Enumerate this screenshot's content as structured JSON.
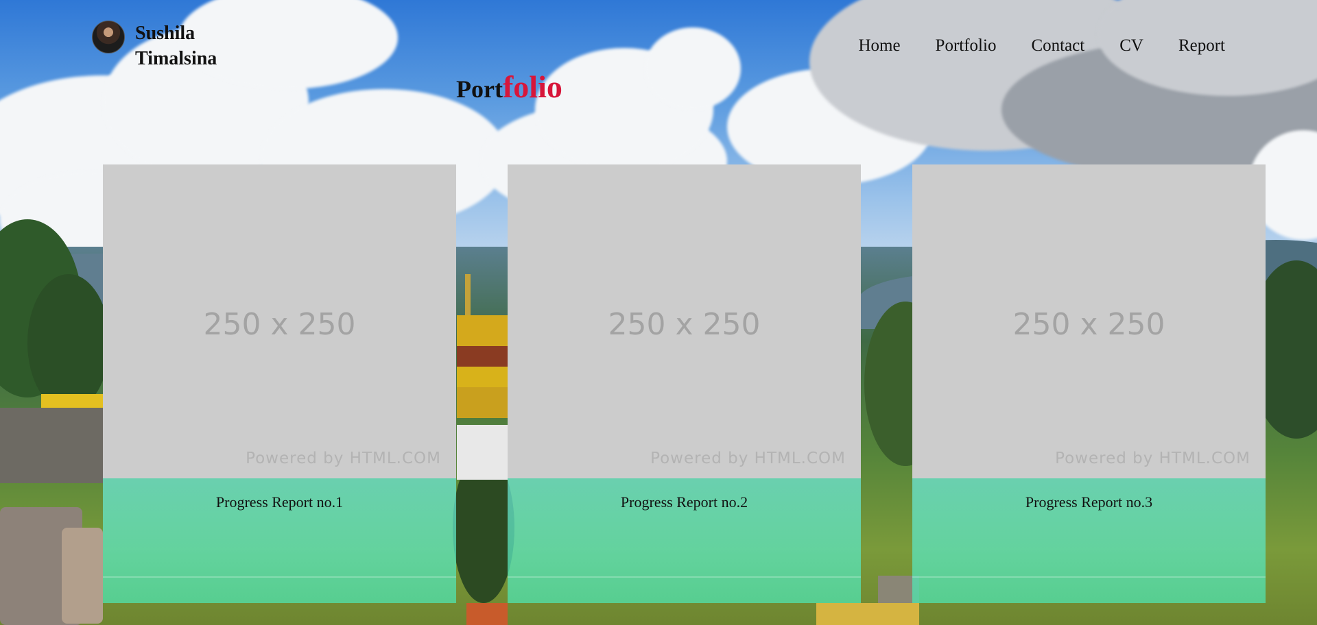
{
  "brand": {
    "name": "Sushila Timalsina"
  },
  "nav": {
    "items": [
      "Home",
      "Portfolio",
      "Contact",
      "CV",
      "Report"
    ]
  },
  "title": {
    "part1": "Port",
    "part2": "folio",
    "accent_color": "#d7163a"
  },
  "cards": [
    {
      "placeholder_size": "250 x 250",
      "placeholder_credit": "Powered by HTML.COM",
      "label": "Progress Report no.1"
    },
    {
      "placeholder_size": "250 x 250",
      "placeholder_credit": "Powered by HTML.COM",
      "label": "Progress Report no.2"
    },
    {
      "placeholder_size": "250 x 250",
      "placeholder_credit": "Powered by HTML.COM",
      "label": "Progress Report no.3"
    }
  ],
  "colors": {
    "caption_teal": "#6eebdc",
    "caption_green": "#50e1aa",
    "placeholder_grey": "#cccccc"
  }
}
